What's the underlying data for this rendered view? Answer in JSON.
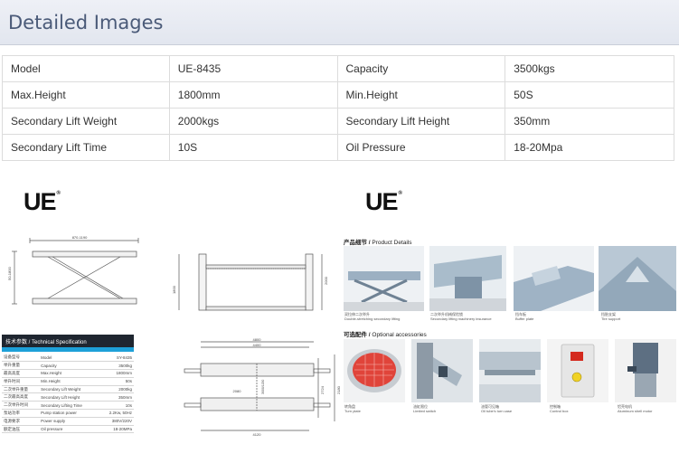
{
  "header": {
    "title": "Detailed Images"
  },
  "specs": [
    [
      {
        "label": "Model",
        "value": "UE-8435"
      },
      {
        "label": "Capacity",
        "value": "3500kgs"
      }
    ],
    [
      {
        "label": "Max.Height",
        "value": "1800mm"
      },
      {
        "label": "Min.Height",
        "value": "50S"
      }
    ],
    [
      {
        "label": "Secondary Lift Weight",
        "value": "2000kgs"
      },
      {
        "label": "Secondary Lift Height",
        "value": "350mm"
      }
    ],
    [
      {
        "label": "Secondary Lift Time",
        "value": "10S"
      },
      {
        "label": "Oil Pressure",
        "value": "18-20Mpa"
      }
    ]
  ],
  "brand": {
    "logo_text": "UE",
    "reg_mark": "®"
  },
  "tech_spec": {
    "title": "技术参数 / Technical Specification",
    "rows": [
      [
        "设备型号",
        "Model",
        "SY-8435"
      ],
      [
        "举升重量",
        "Capacity",
        "3500kg"
      ],
      [
        "最高高度",
        "Max.Height",
        "1800mm"
      ],
      [
        "举升时间",
        "Min.Height",
        "50s"
      ],
      [
        "二次举升重量",
        "Secondary Lift Weight",
        "2000kg"
      ],
      [
        "二次最高高度",
        "Secondary Lift Height",
        "350mm"
      ],
      [
        "二次举升时间",
        "Secondary Lifting Time",
        "10s"
      ],
      [
        "泵站功率",
        "Pump station power",
        "2.2Kw, 50Hz"
      ],
      [
        "电源要求",
        "Power supply",
        "380V/220V"
      ],
      [
        "额定油压",
        "Oil pressure",
        "18-20MPa"
      ]
    ]
  },
  "drawing_dims": {
    "side_top": "870-1190",
    "side_left": "50-1800",
    "front_left": "1800",
    "front_right": "2000",
    "plan_top_a": "4800",
    "plan_top_b": "4400",
    "plan_mid": "2080",
    "plan_mid2": "2724",
    "plan_right": "2180",
    "plan_inner": "3000/1150",
    "plan_bottom": "4120"
  },
  "product_details": {
    "title_cn": "产品细节 / ",
    "title_en": "Product Details",
    "items": [
      {
        "cn": "双拉伸二次举升",
        "en": "Double-stretching secondary lifting"
      },
      {
        "cn": "二次举升机械保险锁",
        "en": "Secondary lifting machinery insurance"
      },
      {
        "cn": "挡车板",
        "en": "Buffer plate"
      },
      {
        "cn": "挡胎支架",
        "en": "Tire support"
      }
    ]
  },
  "optional_accessories": {
    "title_cn": "可选配件 / ",
    "title_en": "Optional accessories",
    "items": [
      {
        "cn": "转角盘",
        "en": "Turn plate"
      },
      {
        "cn": "油缸限位",
        "en": "Limited switch"
      },
      {
        "cn": "油管可见箱",
        "en": "Oil tube's turn case"
      },
      {
        "cn": "控制箱",
        "en": "Control box"
      },
      {
        "cn": "铝壳电机",
        "en": "Aluminum shell motor"
      }
    ]
  },
  "colors": {
    "header_text": "#4a5a78",
    "accent_blue": "#1ea0d8",
    "steel": "#8fa3b5",
    "control_red": "#d42a1e",
    "turnplate_red": "#e0443a"
  }
}
